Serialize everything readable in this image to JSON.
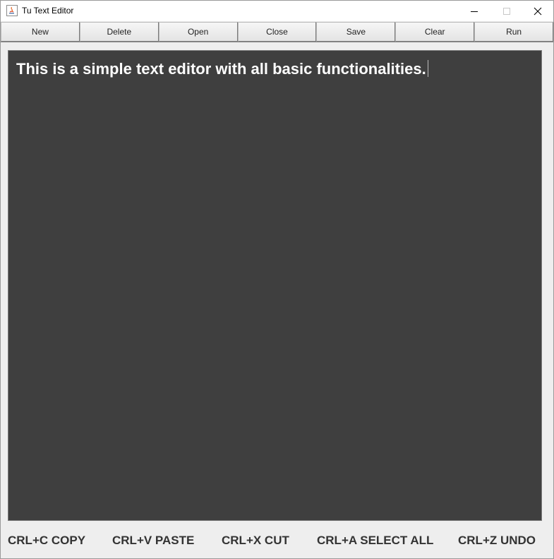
{
  "window": {
    "title": "Tu Text Editor",
    "minimize_icon": "minimize-icon",
    "maximize_icon": "maximize-icon",
    "close_icon": "close-icon"
  },
  "toolbar": {
    "buttons": [
      "New",
      "Delete",
      "Open",
      "Close",
      "Save",
      "Clear",
      "Run"
    ]
  },
  "editor": {
    "text": "This is a simple text editor with all basic functionalities.",
    "background": "#3f3f3f",
    "text_color": "#ffffff"
  },
  "shortcuts": [
    "CRL+C COPY",
    "CRL+V PASTE",
    "CRL+X CUT",
    "CRL+A SELECT ALL",
    "CRL+Z UNDO"
  ]
}
